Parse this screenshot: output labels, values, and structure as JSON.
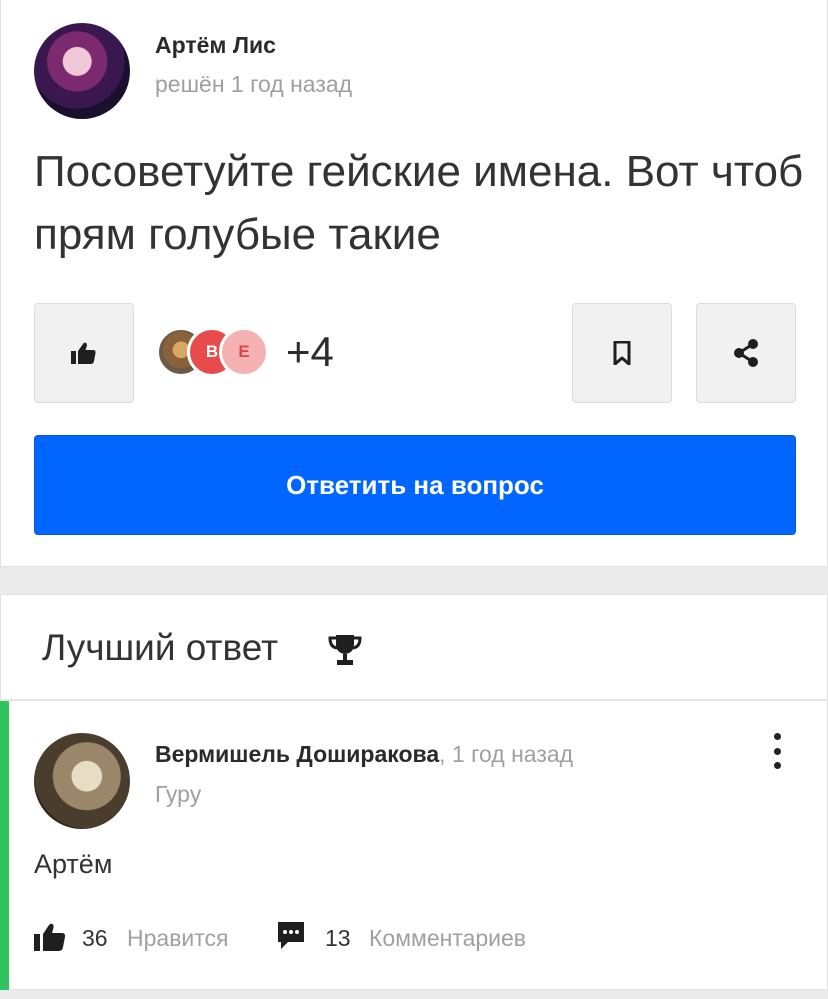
{
  "question": {
    "author": "Артём Лис",
    "solved": "решён 1 год назад",
    "text": "Посоветуйте гейские имена. Вот чтоб прям голубые такие",
    "reactors": [
      "В",
      "Е"
    ],
    "reactions_more": "+4",
    "answer_button": "Ответить на вопрос"
  },
  "best_answer": {
    "heading": "Лучший ответ",
    "author": "Вермишель Доширакова",
    "time": ", 1 год назад",
    "rank": "Гуру",
    "text": "Артём",
    "likes_count": "36",
    "likes_label": "Нравится",
    "comments_count": "13",
    "comments_label": "Комментариев"
  },
  "colors": {
    "primary_button": "#0066ff",
    "best_answer_accent": "#2fc45c"
  },
  "icons": [
    "thumbs-up-icon",
    "bookmark-icon",
    "share-icon",
    "trophy-icon",
    "more-vertical-icon",
    "comment-icon"
  ]
}
